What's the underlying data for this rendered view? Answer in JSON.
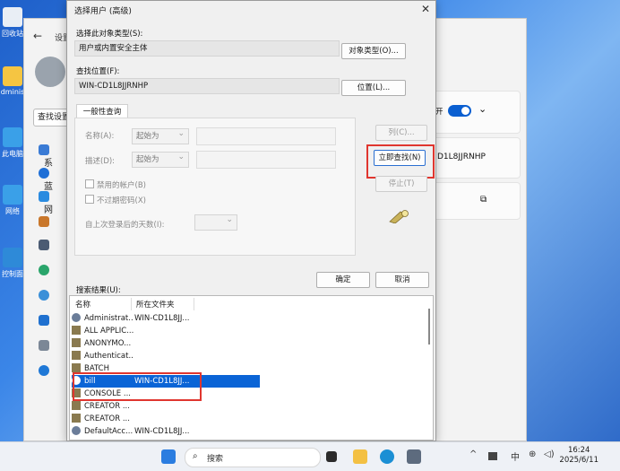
{
  "desktop": {
    "icons": [
      {
        "label": "回收站",
        "color": "#e9eef5"
      },
      {
        "label": "dminis",
        "color": "#f5c542"
      },
      {
        "label": "此电脑",
        "color": "#3aa0e8"
      },
      {
        "label": "网络",
        "color": "#3aa0e8"
      },
      {
        "label": "控制面",
        "color": "#2e8ad8"
      }
    ]
  },
  "settings": {
    "title": "设置",
    "search_label": "查找设置",
    "nav": [
      "系",
      "蓝",
      "网",
      "",
      "",
      "",
      "",
      "",
      "",
      ""
    ],
    "toggle_label": "开",
    "computer_name": "D1L8JJRNHP"
  },
  "dialog": {
    "title": "选择用户 (高级)",
    "object_type_label": "选择此对象类型(S):",
    "object_type_value": "用户或内置安全主体",
    "object_type_button": "对象类型(O)...",
    "location_label": "查找位置(F):",
    "location_value": "WIN-CD1L8JJRNHP",
    "location_button": "位置(L)...",
    "tab_label": "一般性查询",
    "name_label": "名称(A):",
    "name_mode": "起始为",
    "desc_label": "描述(D):",
    "desc_mode": "起始为",
    "disabled_accounts": "禁用的帐户(B)",
    "no_expire_pwd": "不过期密码(X)",
    "days_since_login": "自上次登录后的天数(I):",
    "columns_button": "列(C)...",
    "find_now_button": "立即查找(N)",
    "stop_button": "停止(T)",
    "ok_button": "确定",
    "cancel_button": "取消",
    "results_label": "搜索结果(U):",
    "results_headers": [
      "名称",
      "所在文件夹"
    ],
    "results": [
      {
        "name": "Administrat...",
        "folder": "WIN-CD1L8JJ...",
        "selected": false
      },
      {
        "name": "ALL APPLIC...",
        "folder": "",
        "selected": false
      },
      {
        "name": "ANONYMO...",
        "folder": "",
        "selected": false
      },
      {
        "name": "Authenticat...",
        "folder": "",
        "selected": false
      },
      {
        "name": "BATCH",
        "folder": "",
        "selected": false
      },
      {
        "name": "bill",
        "folder": "WIN-CD1L8JJ...",
        "selected": true
      },
      {
        "name": "CONSOLE ...",
        "folder": "",
        "selected": false
      },
      {
        "name": "CREATOR ...",
        "folder": "",
        "selected": false
      },
      {
        "name": "CREATOR ...",
        "folder": "",
        "selected": false
      },
      {
        "name": "DefaultAcc...",
        "folder": "WIN-CD1L8JJ...",
        "selected": false
      }
    ]
  },
  "taskbar": {
    "search_text": "搜索",
    "tray": {
      "ime": "中",
      "time": "16:24",
      "date": "2025/6/11"
    }
  },
  "colors": {
    "accent": "#0a64d6",
    "highlight_box": "#e0362f"
  }
}
